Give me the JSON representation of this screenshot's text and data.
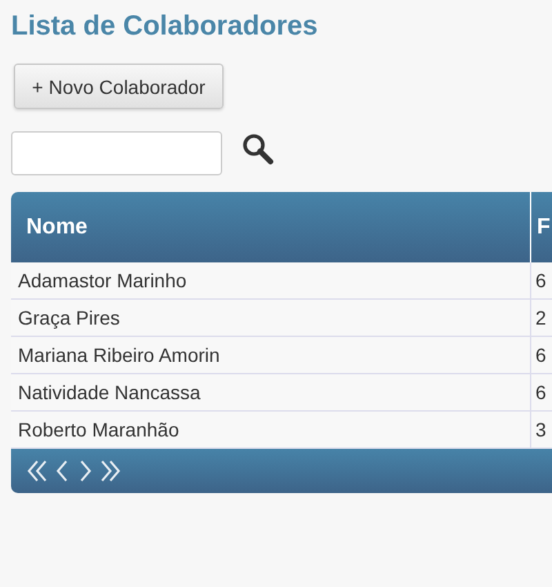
{
  "title": "Lista de Colaboradores",
  "new_button": {
    "label": "+ Novo Colaborador"
  },
  "table": {
    "columns": [
      "Nome",
      "F"
    ],
    "rows": [
      [
        "Adamastor Marinho",
        "6"
      ],
      [
        "Graça Pires",
        "2"
      ],
      [
        "Mariana Ribeiro Amorin",
        "6"
      ],
      [
        "Natividade Nancassa",
        "6"
      ],
      [
        "Roberto Maranhão",
        "3"
      ]
    ]
  },
  "pager": {
    "buttons": [
      {
        "kind": "first"
      },
      {
        "kind": "prev"
      },
      {
        "kind": "next"
      },
      {
        "kind": "last"
      }
    ]
  }
}
